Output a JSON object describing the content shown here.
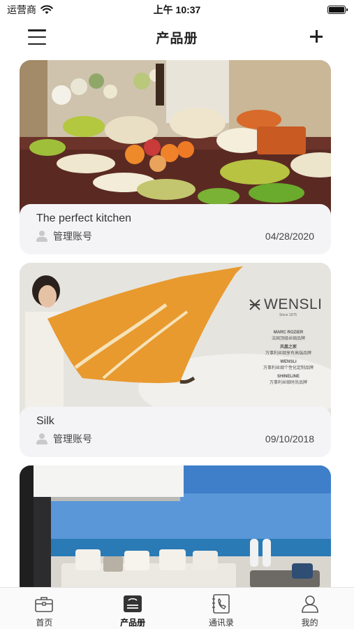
{
  "status_bar": {
    "carrier": "运营商",
    "time": "上午 10:37"
  },
  "header": {
    "title": "产品册"
  },
  "feed": {
    "cards": [
      {
        "title": "The perfect kitchen",
        "author": "管理账号",
        "date": "04/28/2020",
        "image": "tableware-photo"
      },
      {
        "title": "Silk",
        "author": "管理账号",
        "date": "09/10/2018",
        "image": "silk-scarf-ad",
        "ad_text": {
          "brand": "WENSLI",
          "since": "Since 1975",
          "lines": [
            "MARC ROZIER",
            "法国顶级丝绸品牌",
            "风凰之家",
            "万事利丝绸享有高端品牌",
            "WENSLI",
            "万事利丝绸个性化定制品牌",
            "SHINELINE",
            "万事利丝绸时尚品牌"
          ]
        }
      },
      {
        "title": "",
        "author": "",
        "date": "",
        "image": "seaside-terrace-photo"
      }
    ]
  },
  "tab_bar": {
    "tabs": [
      {
        "label": "首页",
        "icon": "briefcase-icon",
        "active": false
      },
      {
        "label": "产品册",
        "icon": "catalog-icon",
        "active": true
      },
      {
        "label": "通讯录",
        "icon": "contacts-phone-icon",
        "active": false
      },
      {
        "label": "我的",
        "icon": "profile-icon",
        "active": false
      }
    ]
  },
  "colors": {
    "accent": "#222222",
    "card_info_bg": "#f4f4f7",
    "tab_bar_bg": "#fafafa"
  }
}
